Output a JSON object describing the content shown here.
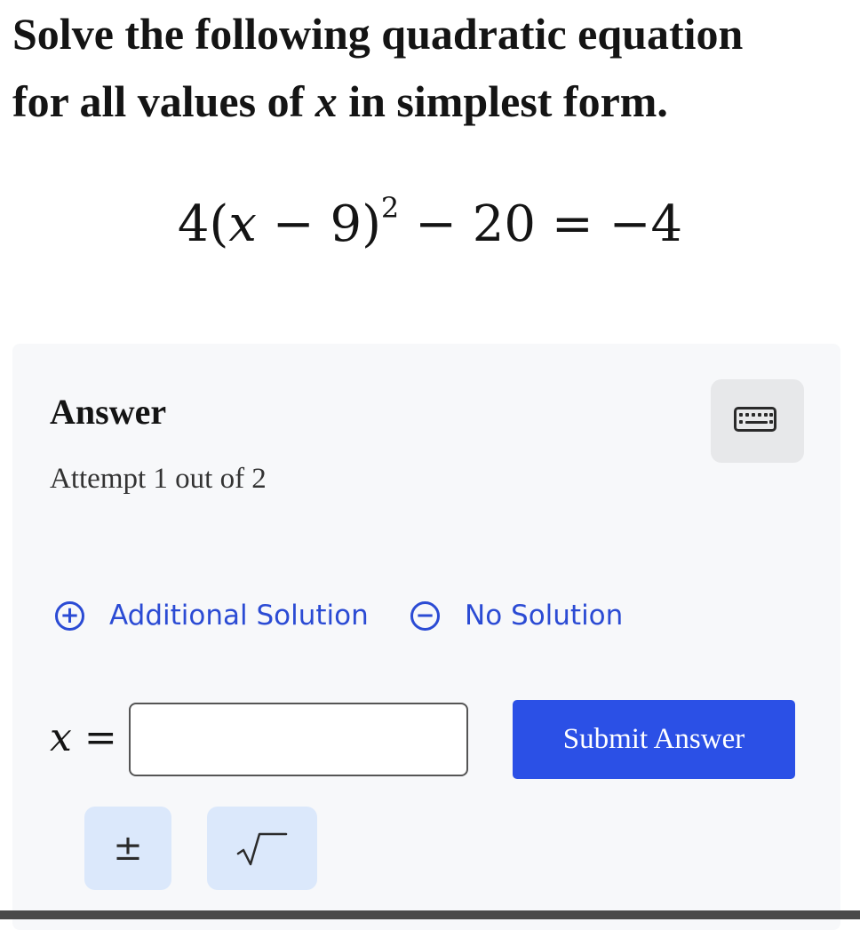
{
  "question": {
    "line1": "Solve the following quadratic equation",
    "line2_prefix": "for all values of ",
    "variable": "x",
    "line2_suffix": " in simplest form."
  },
  "equation": {
    "coefficient": "4(",
    "variable": "x",
    "inner": " − 9)",
    "exponent": "2",
    "rest": " − 20 = −4"
  },
  "answer": {
    "title": "Answer",
    "attempt": "Attempt 1 out of 2",
    "keyboard_icon": "keyboard-icon"
  },
  "options": {
    "additional_solution": "Additional Solution",
    "additional_icon": "plus-circle-icon",
    "no_solution": "No Solution",
    "no_solution_icon": "minus-circle-icon"
  },
  "input": {
    "variable": "x",
    "equals": " =",
    "value": ""
  },
  "submit": {
    "label": "Submit Answer"
  },
  "symbols": {
    "plus_minus": "±",
    "sqrt_icon": "square-root-icon"
  },
  "colors": {
    "accent": "#2b50e6",
    "link": "#2b4bd4",
    "panel_bg": "#f7f8fa",
    "symbol_button_bg": "#dbe8fb",
    "keyboard_button_bg": "#e7e8ea"
  }
}
